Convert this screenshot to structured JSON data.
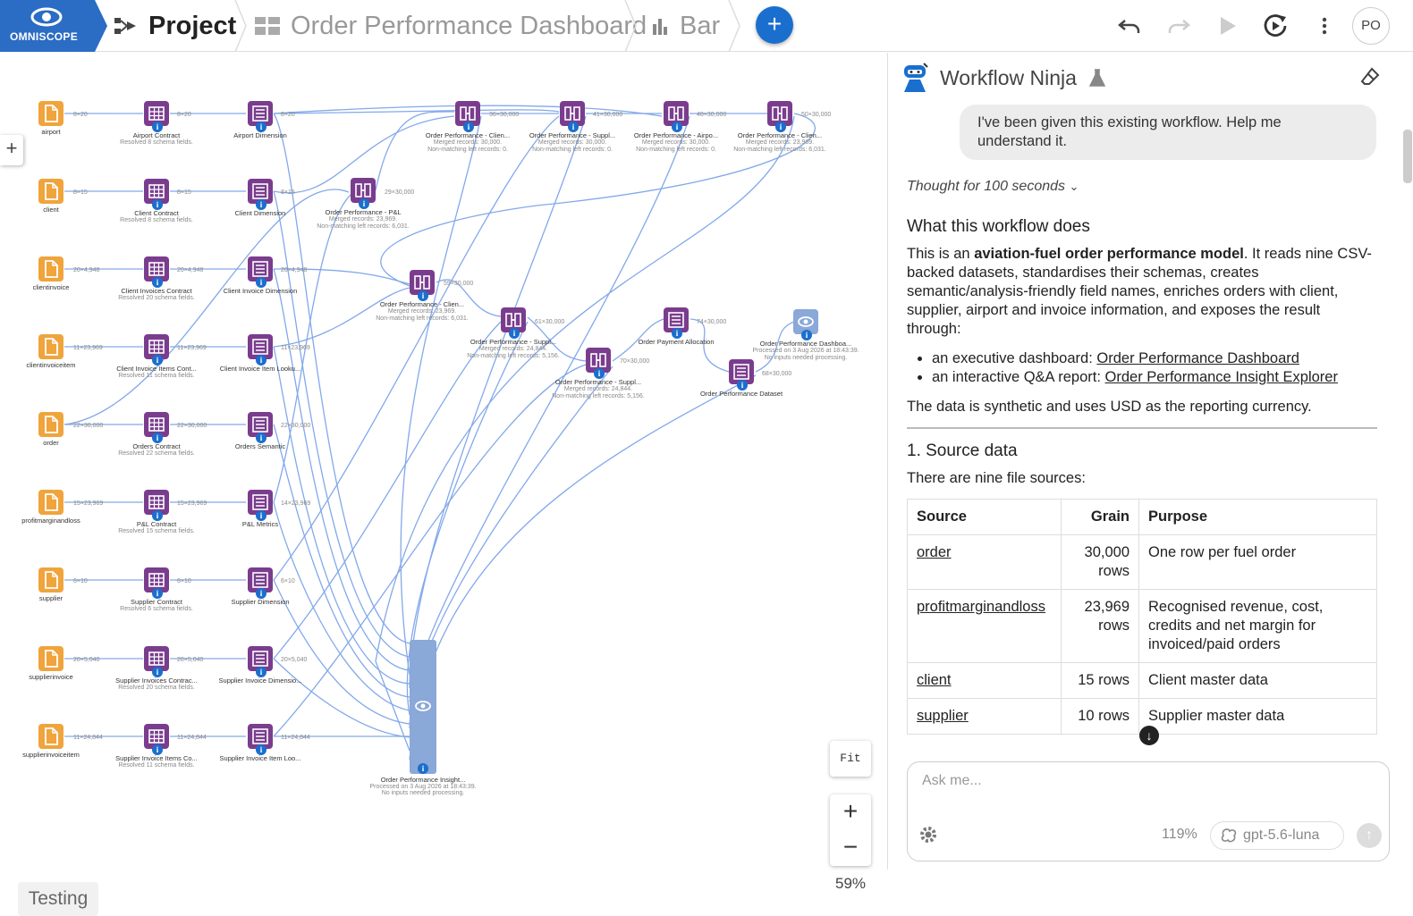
{
  "topbar": {
    "logo_text": "OMNISCOPE",
    "project_label": "Project",
    "dashboard_label": "Order Performance Dashboard",
    "view_label": "Bar",
    "add_button": "+",
    "avatar": "PO",
    "icons": [
      "undo-icon",
      "redo-icon",
      "play-icon",
      "refresh-icon",
      "more-icon"
    ]
  },
  "canvas": {
    "zoom": "59%",
    "fit_label": "Fit",
    "zoom_in": "+",
    "zoom_out": "−",
    "testing_label": "Testing",
    "nodes": {
      "airport": {
        "label": "airport"
      },
      "client": {
        "label": "client"
      },
      "clientinvoice": {
        "label": "clientinvoice"
      },
      "clientinvoiceitem": {
        "label": "clientinvoiceitem"
      },
      "order": {
        "label": "order"
      },
      "profit": {
        "label": "profitmarginandloss"
      },
      "supplier": {
        "label": "supplier"
      },
      "supplierinvoice": {
        "label": "supplierinvoice"
      },
      "supplierinvoiceitem": {
        "label": "supplierinvoiceitem"
      },
      "airport_contract": {
        "label": "Airport Contract",
        "sub": "Resolved 8 schema fields."
      },
      "client_contract": {
        "label": "Client Contract",
        "sub": "Resolved 8 schema fields."
      },
      "ci_contract": {
        "label": "Client Invoices Contract",
        "sub": "Resolved 20 schema fields."
      },
      "cii_contract": {
        "label": "Client Invoice Items Cont...",
        "sub": "Resolved 11 schema fields."
      },
      "orders_contract": {
        "label": "Orders Contract",
        "sub": "Resolved 22 schema fields."
      },
      "pl_contract": {
        "label": "P&L Contract",
        "sub": "Resolved 15 schema fields."
      },
      "supplier_contract": {
        "label": "Supplier Contract",
        "sub": "Resolved 6 schema fields."
      },
      "si_contract": {
        "label": "Supplier Invoices Contrac...",
        "sub": "Resolved 20 schema fields."
      },
      "sii_contract": {
        "label": "Supplier Invoice Items Co...",
        "sub": "Resolved 11 schema fields."
      },
      "airport_dim": {
        "label": "Airport Dimension"
      },
      "client_dim": {
        "label": "Client Dimension"
      },
      "ci_dim": {
        "label": "Client Invoice Dimension"
      },
      "cii_lookup": {
        "label": "Client Invoice Item Looku..."
      },
      "orders_sem": {
        "label": "Orders Semantic"
      },
      "pl_metrics": {
        "label": "P&L Metrics"
      },
      "supplier_dim": {
        "label": "Supplier Dimension"
      },
      "si_dim": {
        "label": "Supplier Invoice Dimensio..."
      },
      "sii_lookup": {
        "label": "Supplier Invoice Item Loo..."
      },
      "op_pl": {
        "label": "Order Performance - P&L",
        "sub": "Merged records: 23,969.",
        "sub2": "Non-matching left records: 6,031."
      },
      "op_client1": {
        "label": "Order Performance - Clien...",
        "sub": "Merged records: 30,000.",
        "sub2": "Non-matching left records: 0."
      },
      "op_supp1": {
        "label": "Order Performance - Suppl...",
        "sub": "Merged records: 30,000.",
        "sub2": "Non-matching left records: 0."
      },
      "op_airport": {
        "label": "Order Performance - Airpo...",
        "sub": "Merged records: 30,000.",
        "sub2": "Non-matching left records: 0."
      },
      "op_client2": {
        "label": "Order Performance - Clien...",
        "sub": "Merged records: 23,969.",
        "sub2": "Non-matching left records: 6,031."
      },
      "op_client3": {
        "label": "Order Performance - Clien...",
        "sub": "Merged records: 23,969.",
        "sub2": "Non-matching left records: 6,031."
      },
      "op_supp2": {
        "label": "Order Performance - Suppl...",
        "sub": "Merged records: 24,844.",
        "sub2": "Non-matching left records: 5,156."
      },
      "op_supp3": {
        "label": "Order Performance - Suppl...",
        "sub": "Merged records: 24,844.",
        "sub2": "Non-matching left records: 5,156."
      },
      "payment_alloc": {
        "label": "Order Payment Allocation"
      },
      "op_dataset": {
        "label": "Order Performance Dataset"
      },
      "op_dashboard": {
        "label": "Order Performance Dashboa...",
        "sub": "Processed on 3 Aug 2026 at 18:43:39.",
        "sub2": "No inputs needed processing."
      },
      "op_insight": {
        "label": "Order Performance Insight...",
        "sub": "Processed on 3 Aug 2026 at 18:43:39.",
        "sub2": "No inputs needed processing."
      }
    },
    "dims": {
      "d1": "8×20",
      "d2": "8×20",
      "d3": "8×20",
      "d4": "8×15",
      "d5": "8×15",
      "d6": "8×15",
      "d7": "20×4,948",
      "d8": "20×4,948",
      "d9": "20×4,948",
      "d10": "11×23,969",
      "d11": "11×23,969",
      "d12": "11×23,969",
      "d13": "22×30,000",
      "d14": "22×30,000",
      "d15": "22×30,000",
      "d16": "15×23,969",
      "d17": "15×23,969",
      "d18": "14×23,969",
      "d19": "6×10",
      "d20": "6×10",
      "d21": "6×10",
      "d22": "20×5,040",
      "d23": "20×5,040",
      "d24": "20×5,040",
      "d25": "11×24,844",
      "d26": "11×24,844",
      "d27": "11×24,844",
      "d28": "36×30,000",
      "d29": "41×30,000",
      "d30": "48×30,000",
      "d31": "50×30,000",
      "d32": "29×30,000",
      "d33": "59×30,000",
      "d34": "61×30,000",
      "d35": "70×30,000",
      "d36": "74×30,000",
      "d37": "68×30,000"
    }
  },
  "panel": {
    "title": "Workflow Ninja",
    "user_message": "I've been given this existing workflow. Help me understand it.",
    "thought": "Thought for 100 seconds",
    "h_what": "What this workflow does",
    "p1_pre": "This is an ",
    "p1_bold": "aviation-fuel order performance model",
    "p1_post": ". It reads nine CSV-backed datasets, standardises their schemas, creates semantic/analysis-friendly field names, enriches orders with client, supplier, airport and invoice information, and exposes the result through:",
    "bullet1_pre": "an executive dashboard: ",
    "bullet1_link": "Order Performance Dashboard",
    "bullet2_pre": "an interactive Q&A report: ",
    "bullet2_link": "Order Performance Insight Explorer",
    "p2": "The data is synthetic and uses USD as the reporting currency.",
    "h_source": "1. Source data",
    "p3": "There are nine file sources:",
    "table": {
      "headers": [
        "Source",
        "Grain",
        "Purpose"
      ],
      "rows": [
        {
          "source": "order",
          "grain": "30,000 rows",
          "purpose": "One row per fuel order"
        },
        {
          "source": "profitmarginandloss",
          "grain": "23,969 rows",
          "purpose": "Recognised revenue, cost, credits and net margin for invoiced/paid orders"
        },
        {
          "source": "client",
          "grain": "15 rows",
          "purpose": "Client master data"
        },
        {
          "source": "supplier",
          "grain": "10 rows",
          "purpose": "Supplier master data"
        }
      ]
    },
    "input_placeholder": "Ask me...",
    "context_pct": "119%",
    "model": "gpt-5.6-luna"
  }
}
